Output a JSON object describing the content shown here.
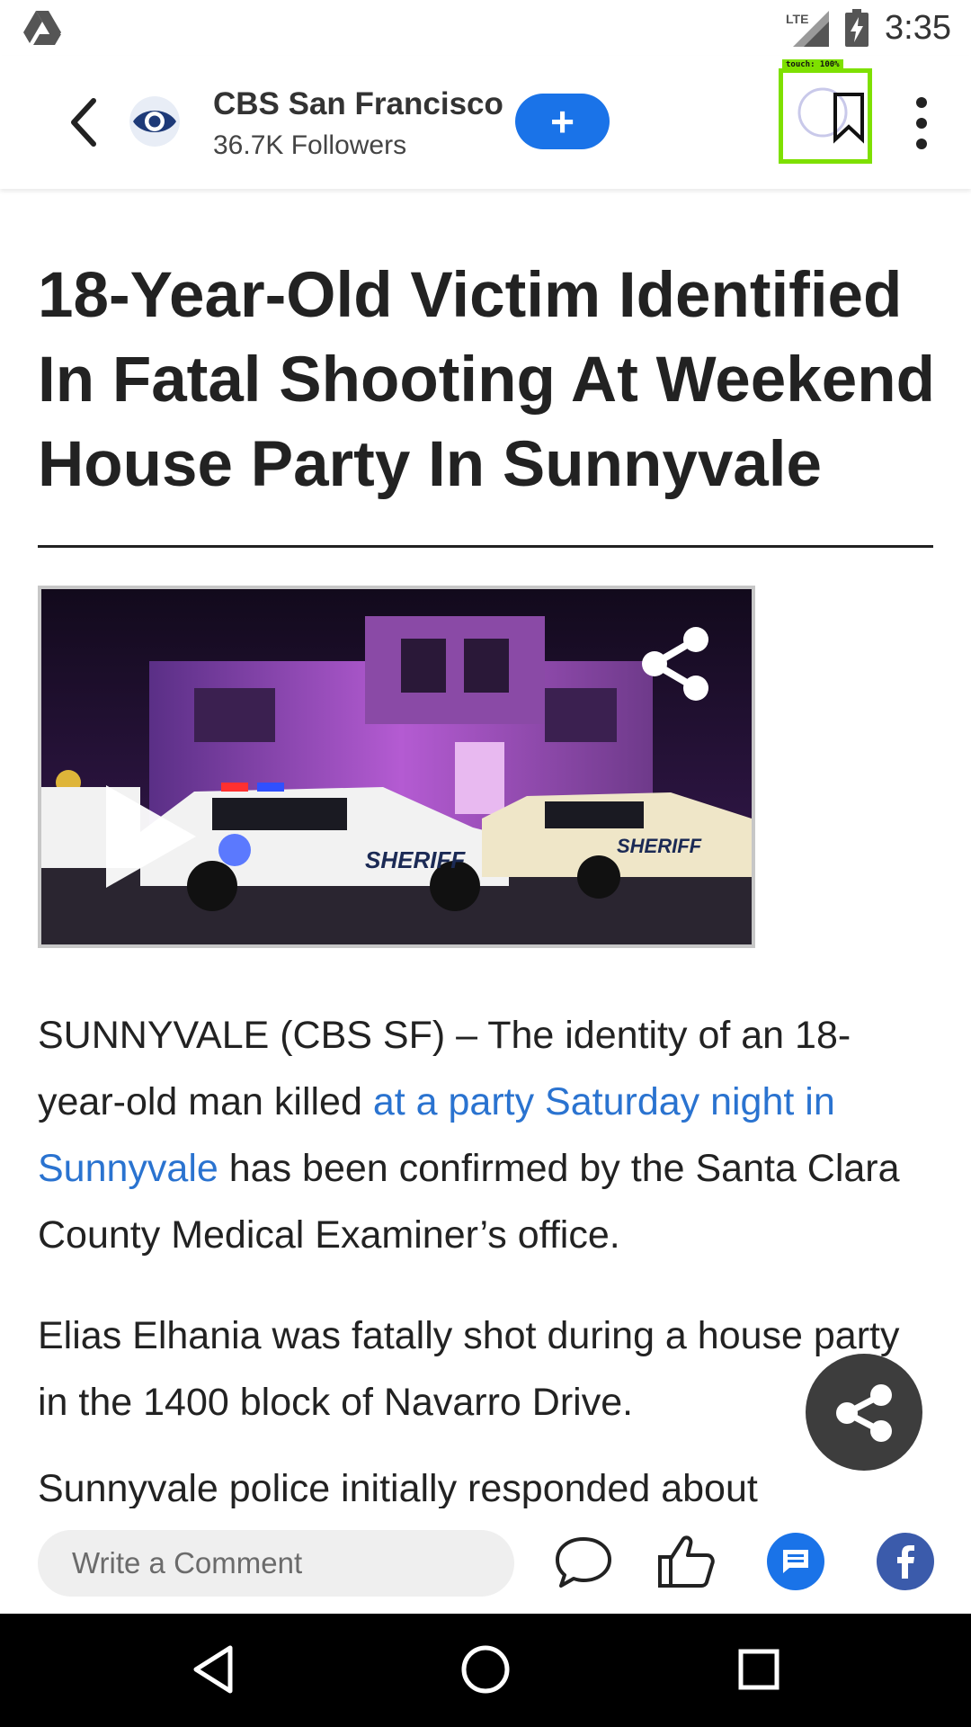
{
  "status_bar": {
    "time": "3:35",
    "network": "LTE",
    "icons": [
      "drive-icon",
      "signal-icon",
      "battery-charging-icon"
    ]
  },
  "header": {
    "source_name": "CBS San Francisco",
    "followers": "36.7K Followers",
    "follow_label": "+",
    "touch_label": "touch: 100%",
    "icons": [
      "back-arrow-icon",
      "cbs-eye-logo",
      "bookmark-icon",
      "more-vert-icon"
    ]
  },
  "article": {
    "headline": "18-Year-Old Victim Identified In Fatal Shooting At Weekend House Party In Sunnyvale",
    "video": {
      "icons": [
        "play-icon",
        "share-icon"
      ],
      "car_label_1": "SHERIFF",
      "car_label_2": "SHERIFF"
    },
    "p1_before": "SUNNYVALE (CBS SF) – The identity of an 18-year-old man killed ",
    "p1_link": "at a party Saturday night in Sunnyvale",
    "p1_after": " has been confirmed by the Santa Clara County Medical Examiner’s office.",
    "p2": "Elias Elhania was fatally shot during a house party in the 1400 block of Navarro Drive.",
    "p3": "Sunnyvale police initially responded about"
  },
  "bottom_bar": {
    "comment_placeholder": "Write a Comment",
    "icons": [
      "comment-bubble-icon",
      "thumbs-up-icon",
      "message-icon",
      "facebook-icon"
    ]
  },
  "fab": {
    "icon": "share-icon"
  },
  "nav": {
    "icons": [
      "nav-back-icon",
      "nav-home-icon",
      "nav-recents-icon"
    ]
  },
  "colors": {
    "accent": "#1a73e8",
    "link": "#2a73d0",
    "facebook": "#3b5bab",
    "touch_highlight": "#7ee000"
  }
}
